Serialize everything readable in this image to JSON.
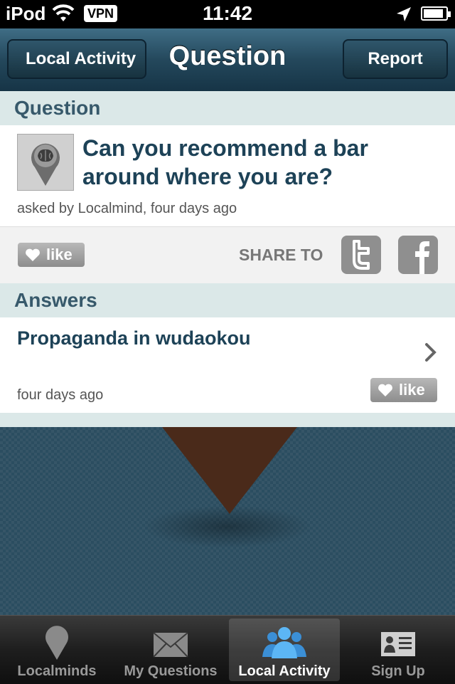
{
  "status_bar": {
    "carrier": "iPod",
    "vpn": "VPN",
    "time": "11:42",
    "battery_level": 0.9
  },
  "nav": {
    "back_label": "Local Activity",
    "title": "Question",
    "report_label": "Report"
  },
  "question_section": {
    "header": "Question",
    "text": "Can you recommend a bar around where you are?",
    "asked_by": "asked by Localmind, four days ago",
    "like_label": "like",
    "share_label": "SHARE TO"
  },
  "answers_section": {
    "header": "Answers",
    "items": [
      {
        "text": "Propaganda in wudaokou",
        "time": "four days ago",
        "like_label": "like"
      }
    ]
  },
  "tabs": [
    {
      "label": "Localminds",
      "icon": "pin-icon"
    },
    {
      "label": "My Questions",
      "icon": "envelope-icon"
    },
    {
      "label": "Local Activity",
      "icon": "people-icon",
      "active": true
    },
    {
      "label": "Sign Up",
      "icon": "id-card-icon"
    }
  ],
  "colors": {
    "nav_bg": "#24485c",
    "section_header_bg": "#dbe8e8",
    "title_text": "#1d4257",
    "accent_blue": "#3b9be6"
  }
}
